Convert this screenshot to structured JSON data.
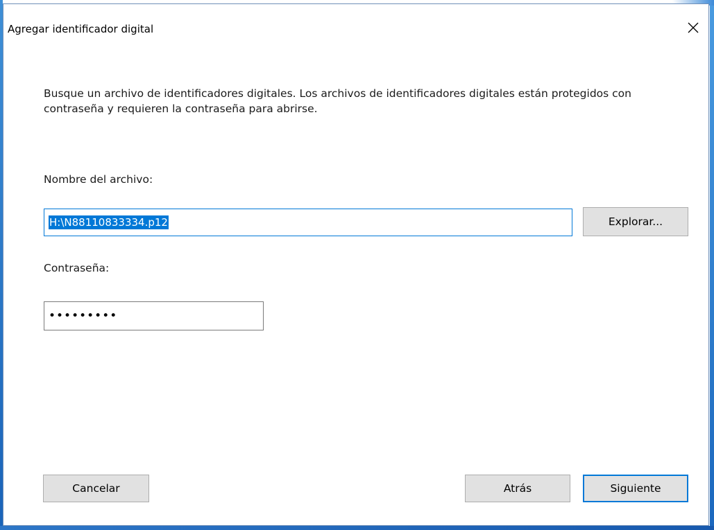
{
  "dialog": {
    "title": "Agregar identificador digital",
    "description": "Busque un archivo de identificadores digitales. Los archivos de identificadores digitales están protegidos con contraseña y requieren la contraseña para abrirse."
  },
  "file_field": {
    "label": "Nombre del archivo:",
    "value": "H:\\N88110833334.p12",
    "browse_label": "Explorar..."
  },
  "password_field": {
    "label": "Contraseña:",
    "masked_value": "•••••••••"
  },
  "footer": {
    "cancel_label": "Cancelar",
    "back_label": "Atrás",
    "next_label": "Siguiente"
  },
  "icons": {
    "close": "close-icon"
  },
  "colors": {
    "accent": "#0078d7",
    "button_bg": "#e1e1e1"
  }
}
